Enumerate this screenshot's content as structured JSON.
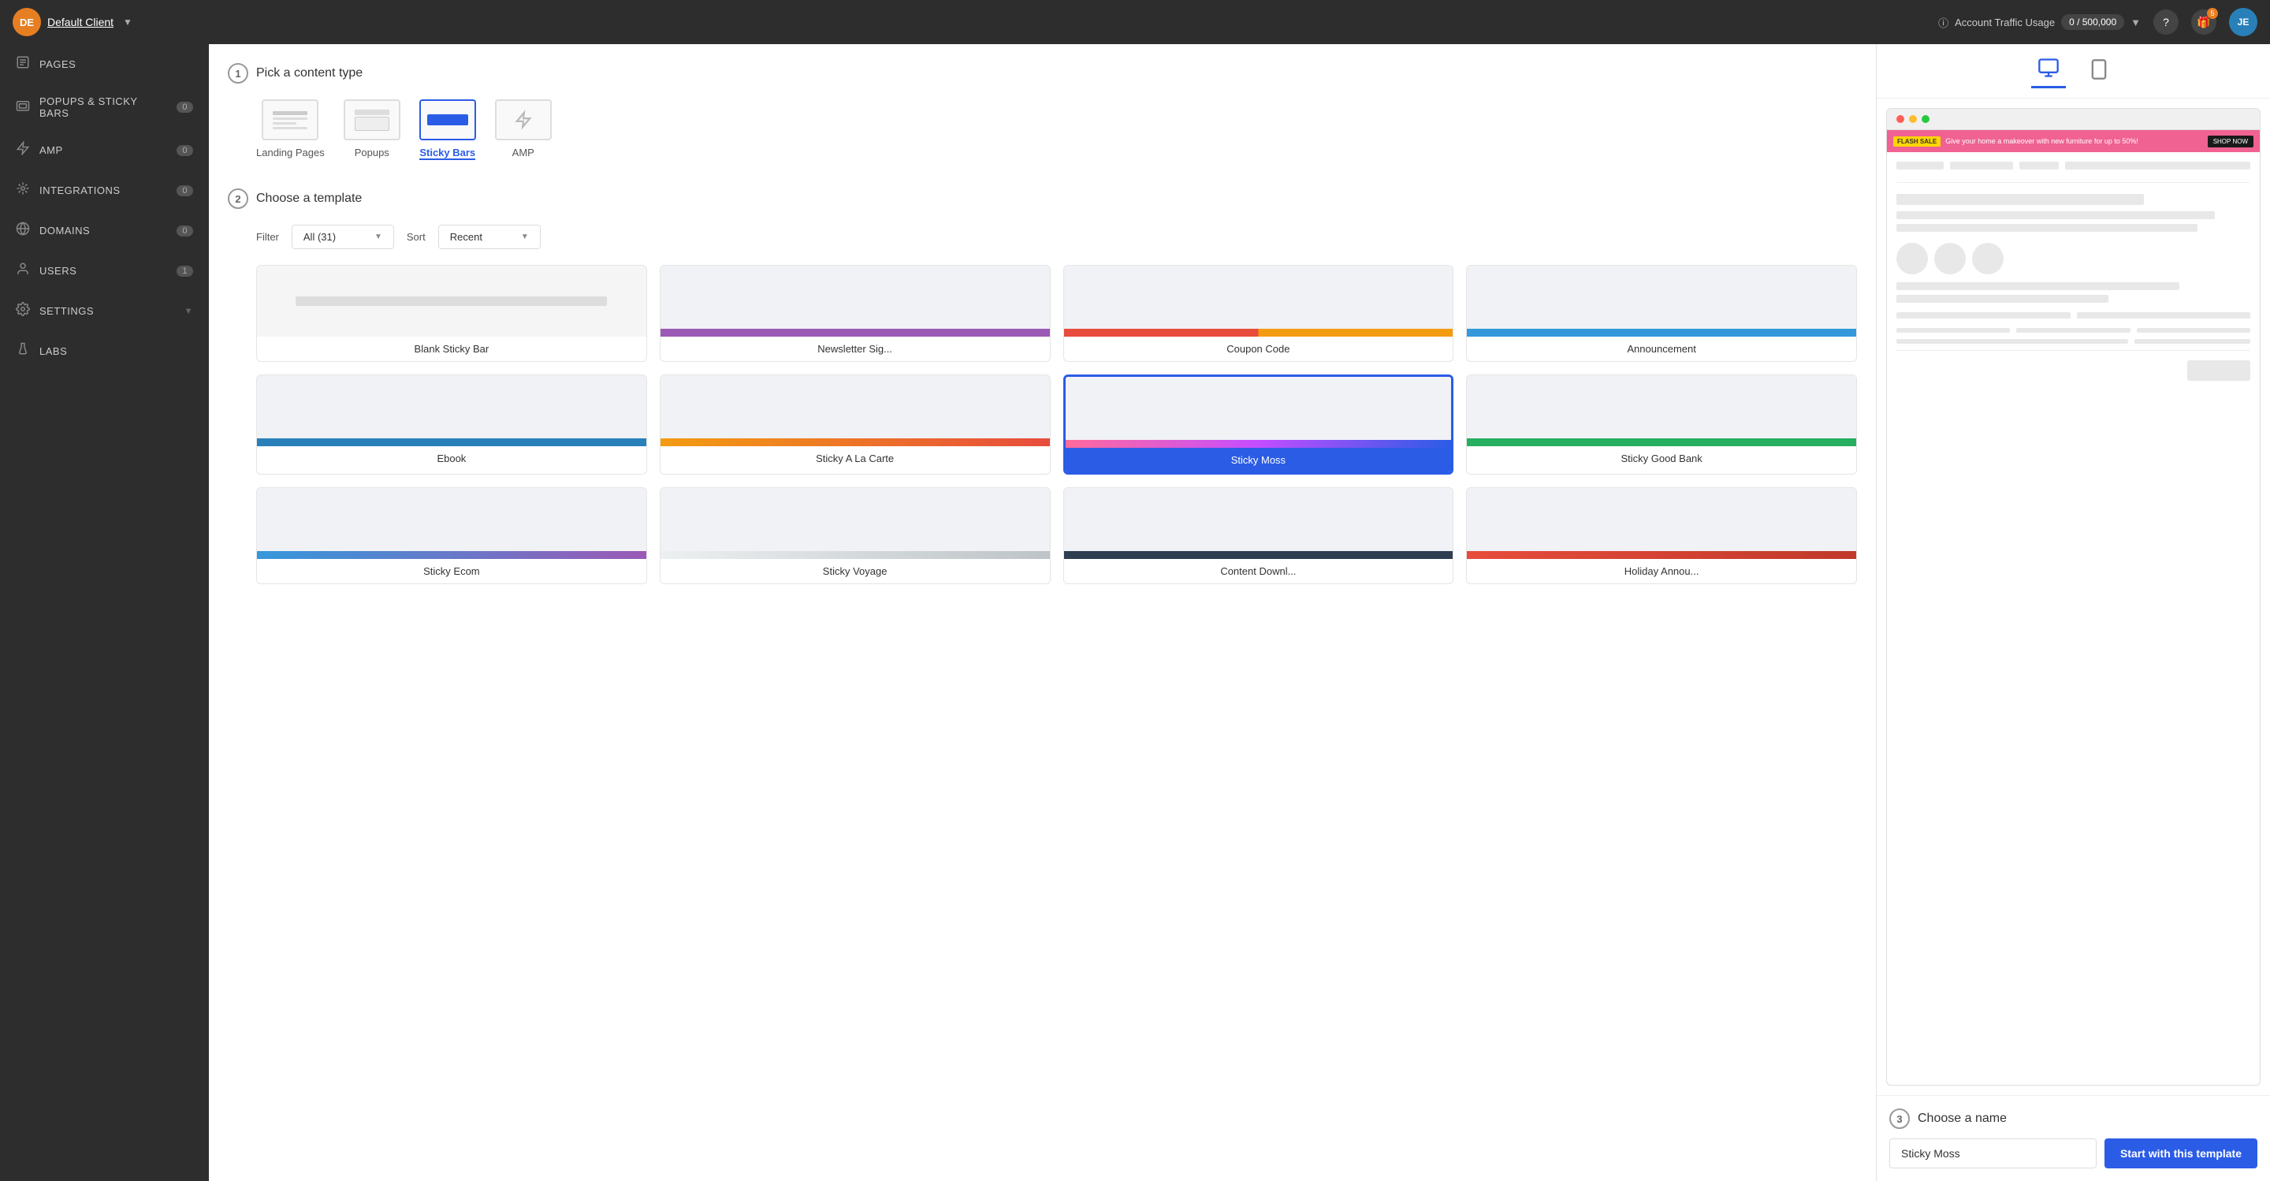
{
  "header": {
    "avatar": "DE",
    "client_name": "Default Client",
    "traffic_label": "Account Traffic Usage",
    "traffic_value": "0 / 500,000",
    "help_icon": "?",
    "gift_icon": "🎁",
    "gift_badge": "5",
    "user_avatar": "JE"
  },
  "sidebar": {
    "items": [
      {
        "label": "Pages",
        "icon": "📄",
        "count": null
      },
      {
        "label": "Popups & Sticky Bars",
        "icon": "🪟",
        "count": "0"
      },
      {
        "label": "AMP",
        "icon": "⚡",
        "count": "0"
      },
      {
        "label": "Integrations",
        "icon": "🔗",
        "count": "0"
      },
      {
        "label": "Domains",
        "icon": "🌐",
        "count": "0"
      },
      {
        "label": "Users",
        "icon": "👤",
        "count": "1"
      },
      {
        "label": "Settings",
        "icon": "⚙",
        "count": null,
        "hasChevron": true
      },
      {
        "label": "Labs",
        "icon": "🧪",
        "count": null
      }
    ]
  },
  "steps": {
    "step1": {
      "number": "1",
      "title": "Pick a content type",
      "tabs": [
        {
          "id": "landing",
          "label": "Landing Pages",
          "active": false
        },
        {
          "id": "popups",
          "label": "Popups",
          "active": false
        },
        {
          "id": "sticky",
          "label": "Sticky Bars",
          "active": true
        },
        {
          "id": "amp",
          "label": "AMP",
          "active": false
        }
      ]
    },
    "step2": {
      "number": "2",
      "title": "Choose a template",
      "filter_label": "Filter",
      "filter_value": "All (31)",
      "sort_label": "Sort",
      "sort_value": "Recent",
      "templates": [
        {
          "id": "blank",
          "name": "Blank Sticky Bar",
          "selected": false
        },
        {
          "id": "newsletter",
          "name": "Newsletter Sig...",
          "selected": false
        },
        {
          "id": "coupon",
          "name": "Coupon Code",
          "selected": false
        },
        {
          "id": "announcement",
          "name": "Announcement",
          "selected": false
        },
        {
          "id": "ebook",
          "name": "Ebook",
          "selected": false
        },
        {
          "id": "alacarte",
          "name": "Sticky A La Carte",
          "selected": false
        },
        {
          "id": "moss",
          "name": "Sticky Moss",
          "selected": true
        },
        {
          "id": "goodbank",
          "name": "Sticky Good Bank",
          "selected": false
        },
        {
          "id": "ecom",
          "name": "Sticky Ecom",
          "selected": false
        },
        {
          "id": "voyage",
          "name": "Sticky Voyage",
          "selected": false
        },
        {
          "id": "contentdl",
          "name": "Content Downl...",
          "selected": false
        },
        {
          "id": "holiday",
          "name": "Holiday Annou...",
          "selected": false
        }
      ]
    },
    "step3": {
      "number": "3",
      "title": "Choose a name",
      "name_placeholder": "Sticky Moss",
      "name_value": "Sticky Moss",
      "start_btn": "Start with this template"
    }
  },
  "preview": {
    "desktop_label": "Desktop",
    "mobile_label": "Mobile",
    "sticky_bar": {
      "flash_badge": "FLASH SALE",
      "text": "Give your home a makeover with new furniture for up to 50%!",
      "btn": "SHOP NOW"
    }
  }
}
